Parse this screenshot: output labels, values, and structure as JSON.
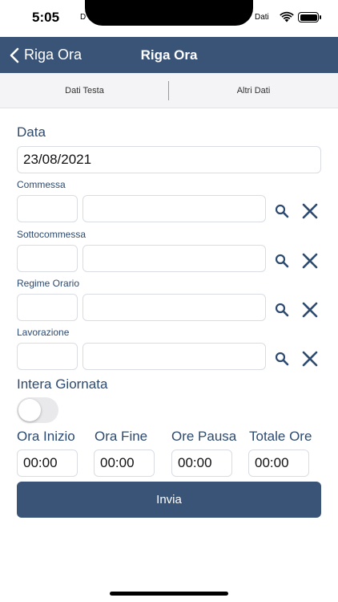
{
  "status_bar": {
    "time": "5:05",
    "carrier_left": "D",
    "carrier_right": "Dati"
  },
  "navbar": {
    "back_label": "Riga Ora",
    "title": "Riga Ora"
  },
  "tabs": [
    {
      "label": "Dati Testa"
    },
    {
      "label": "Altri Dati"
    }
  ],
  "form": {
    "data": {
      "label": "Data",
      "value": "23/08/2021"
    },
    "commessa": {
      "label": "Commessa",
      "code": "",
      "description": ""
    },
    "sottocommessa": {
      "label": "Sottocommessa",
      "code": "",
      "description": ""
    },
    "regime_orario": {
      "label": "Regime Orario",
      "code": "",
      "description": ""
    },
    "lavorazione": {
      "label": "Lavorazione",
      "code": "",
      "description": ""
    },
    "intera_giornata": {
      "label": "Intera Giornata",
      "on": false
    },
    "ora_inizio": {
      "label": "Ora Inizio",
      "value": "00:00"
    },
    "ora_fine": {
      "label": "Ora Fine",
      "value": "00:00"
    },
    "ore_pausa": {
      "label": "Ore Pausa",
      "value": "00:00"
    },
    "totale_ore": {
      "label": "Totale Ore",
      "value": "00:00"
    },
    "submit_label": "Invia"
  },
  "colors": {
    "primary": "#3a5478",
    "label_text": "#2d4a6f",
    "icon": "#2d4a6f"
  }
}
